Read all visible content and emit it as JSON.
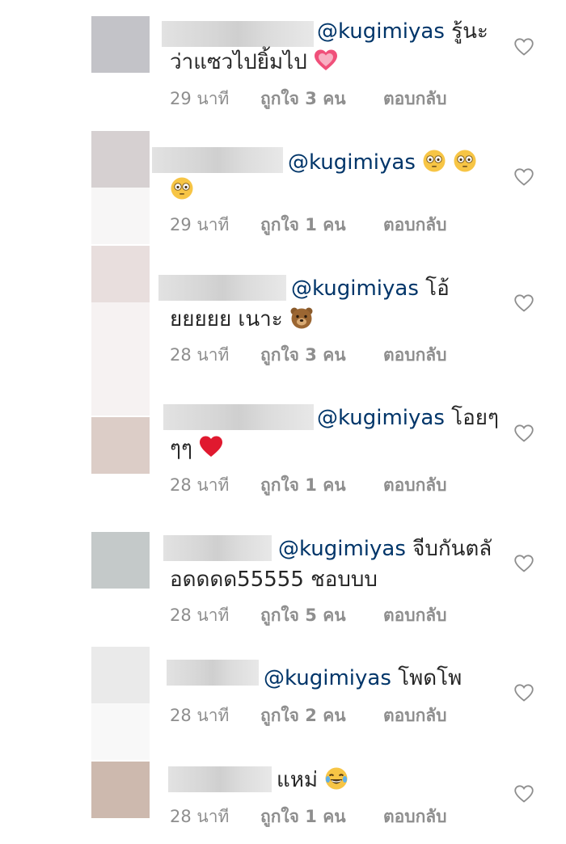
{
  "comments": [
    {
      "mention": "@kugimiyas",
      "line1_after": " รู้นะ",
      "line2": "ว่าแซวไปยิ้มไป",
      "emoji": "heart-pulse",
      "time": "29 นาที",
      "likes": "ถูกใจ 3 คน",
      "reply": "ตอบกลับ",
      "avatar_color": "#c3c3c8"
    },
    {
      "mention": "@kugimiyas",
      "line1_after": "",
      "line2": "",
      "emoji": "flushed",
      "time": "29 นาที",
      "likes": "ถูกใจ 1 คน",
      "reply": "ตอบกลับ",
      "avatar_color": "#d6d0d1"
    },
    {
      "mention": "@kugimiyas",
      "line1_after": " โอ้",
      "line2": "ยยยยย เนาะ",
      "emoji": "bear",
      "time": "28 นาที",
      "likes": "ถูกใจ 3 คน",
      "reply": "ตอบกลับ",
      "avatar_color": "#e8dedd"
    },
    {
      "mention": "@kugimiyas",
      "line1_after": " โอยๆ",
      "line2": "ๆๆ",
      "emoji": "red-heart",
      "time": "28 นาที",
      "likes": "ถูกใจ 1 คน",
      "reply": "ตอบกลับ",
      "avatar_color": "#dccdc7"
    },
    {
      "mention": "@kugimiyas",
      "line1_after": " จีบกันตลั",
      "line2": "อดดดด55555 ชอบบบ",
      "emoji": "",
      "time": "28 นาที",
      "likes": "ถูกใจ 5 คน",
      "reply": "ตอบกลับ",
      "avatar_color": "#c4c9c9"
    },
    {
      "mention": "@kugimiyas",
      "line1_after": " โพดโพ",
      "line2": "",
      "emoji": "",
      "time": "28 นาที",
      "likes": "ถูกใจ 2 คน",
      "reply": "ตอบกลับ",
      "avatar_color": "#eaeaea"
    },
    {
      "mention": "",
      "line1_after": "แหม่",
      "line2": "",
      "emoji": "tears-of-joy",
      "time": "28 นาที",
      "likes": "ถูกใจ 1 คน",
      "reply": "ตอบกลับ",
      "avatar_color": "#cdb9ae"
    }
  ],
  "colors": {
    "mention": "#003569",
    "meta": "#8e8e8e",
    "text": "#262626"
  }
}
